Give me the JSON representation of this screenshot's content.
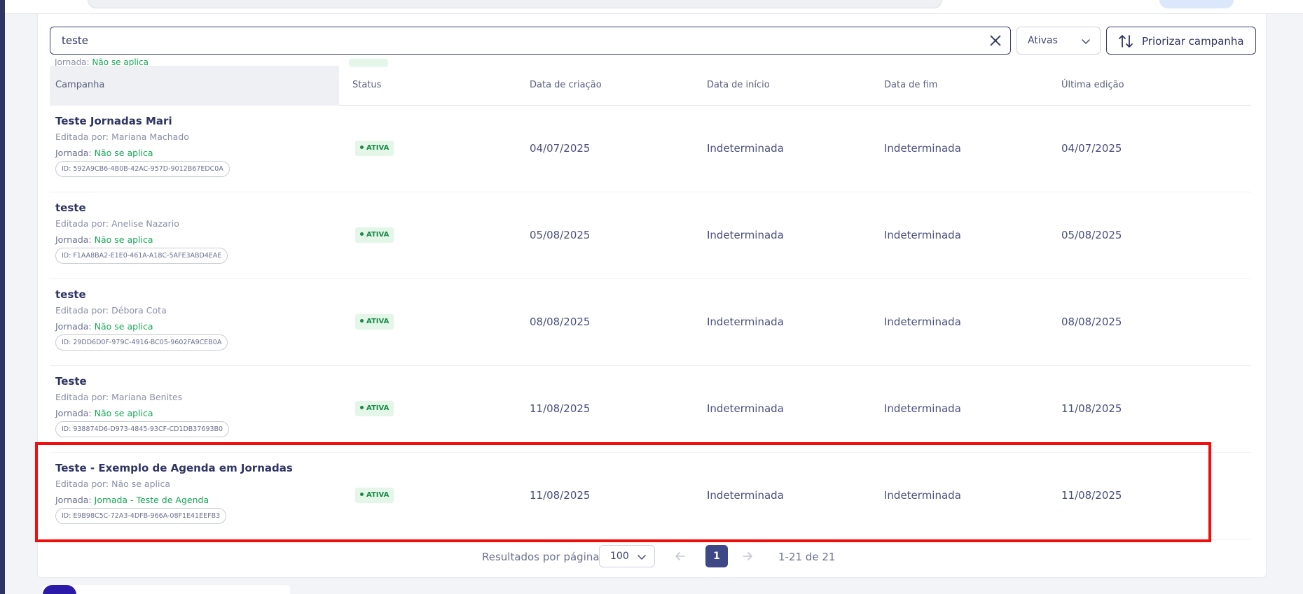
{
  "search": {
    "value": "teste"
  },
  "filter": {
    "selected": "Ativas"
  },
  "prioritize_button": {
    "label": "Priorizar campanha"
  },
  "ghost_row": {
    "jornada_label": "Jornada:",
    "jornada_value": "Não se aplica"
  },
  "table": {
    "headers": [
      "Campanha",
      "Status",
      "Data de criação",
      "Data de início",
      "Data de fim",
      "Última edição"
    ],
    "edit_prefix": "Editada por:",
    "jornada_prefix": "Jornada:",
    "rows": [
      {
        "title": "Teste Jornadas Mari",
        "edited_by": "Mariana Machado",
        "jornada": "Não se aplica",
        "id": "ID: 592A9CB6-4B0B-42AC-957D-9012B67EDC0A",
        "status": "ATIVA",
        "created": "04/07/2025",
        "start": "Indeterminada",
        "end": "Indeterminada",
        "last_edit": "04/07/2025"
      },
      {
        "title": "teste",
        "edited_by": "Anelise Nazario",
        "jornada": "Não se aplica",
        "id": "ID: F1AA8BA2-E1E0-461A-A18C-5AFE3ABD4EAE",
        "status": "ATIVA",
        "created": "05/08/2025",
        "start": "Indeterminada",
        "end": "Indeterminada",
        "last_edit": "05/08/2025"
      },
      {
        "title": "teste",
        "edited_by": "Débora Cota",
        "jornada": "Não se aplica",
        "id": "ID: 29DD6D0F-979C-4916-BC05-9602FA9CEB0A",
        "status": "ATIVA",
        "created": "08/08/2025",
        "start": "Indeterminada",
        "end": "Indeterminada",
        "last_edit": "08/08/2025"
      },
      {
        "title": "Teste",
        "edited_by": "Mariana Benites",
        "jornada": "Não se aplica",
        "id": "ID: 938874D6-D973-4845-93CF-CD1DB37693B0",
        "status": "ATIVA",
        "created": "11/08/2025",
        "start": "Indeterminada",
        "end": "Indeterminada",
        "last_edit": "11/08/2025"
      },
      {
        "title": "Teste - Exemplo de Agenda em Jornadas",
        "edited_by": "Não se aplica",
        "jornada": "Jornada - Teste de Agenda",
        "id": "ID: E9B98C5C-72A3-4DFB-966A-08F1E41EEFB3",
        "status": "ATIVA",
        "created": "11/08/2025",
        "start": "Indeterminada",
        "end": "Indeterminada",
        "last_edit": "11/08/2025"
      }
    ]
  },
  "pagination": {
    "label": "Resultados por página",
    "per_page": "100",
    "current_page": "1",
    "range": "1-21 de 21"
  },
  "colors": {
    "primary": "#3f4886",
    "accent_green": "#18a957",
    "highlight": "#f20d0d",
    "sidebar": "#2f3463"
  }
}
